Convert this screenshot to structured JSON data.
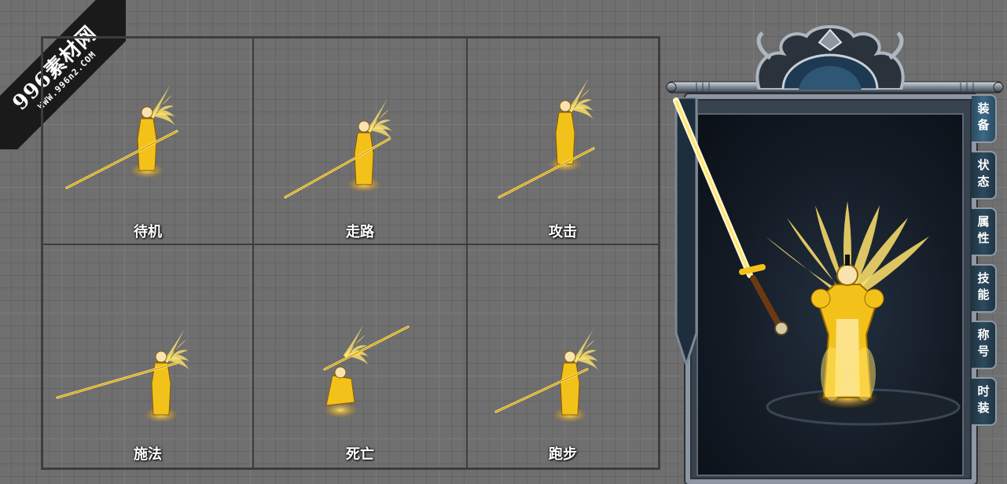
{
  "watermark": {
    "title": "996素材网",
    "url": "WWW.996n2.COM"
  },
  "animation_cells": [
    {
      "id": "idle",
      "label": "待机"
    },
    {
      "id": "walk",
      "label": "走路"
    },
    {
      "id": "attack",
      "label": "攻击"
    },
    {
      "id": "cast",
      "label": "施法"
    },
    {
      "id": "death",
      "label": "死亡"
    },
    {
      "id": "run",
      "label": "跑步"
    }
  ],
  "character_panel": {
    "tabs": [
      {
        "label": "装备",
        "active": true
      },
      {
        "label": "状态",
        "active": false
      },
      {
        "label": "属性",
        "active": false
      },
      {
        "label": "技能",
        "active": false
      },
      {
        "label": "称号",
        "active": false
      },
      {
        "label": "时装",
        "active": false
      }
    ]
  },
  "colors": {
    "gold": "#f3c21a",
    "glow": "#ffe36b",
    "frame_steel": "#8e97a1",
    "panel_bg": "#141b25",
    "grid_bg": "#6f6f6f"
  }
}
